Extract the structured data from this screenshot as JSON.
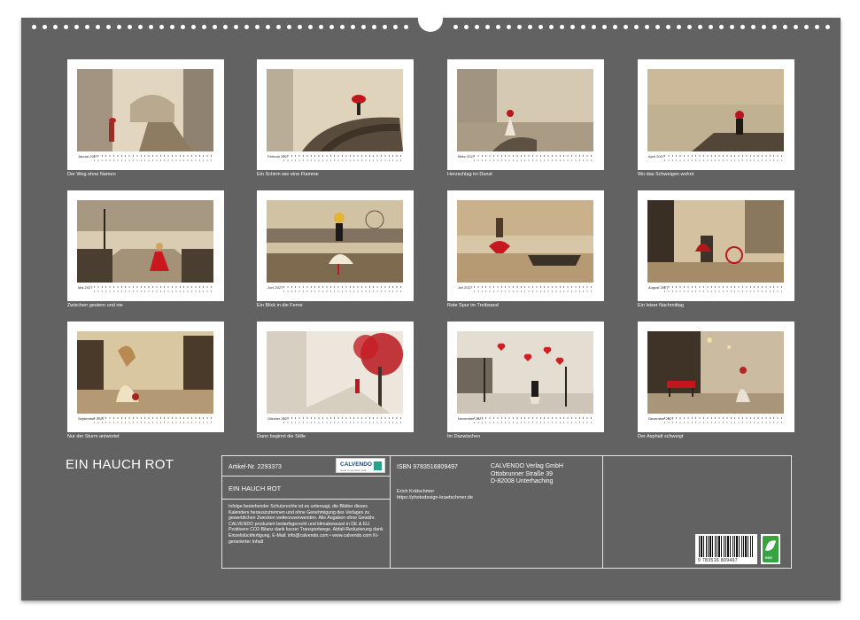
{
  "calendar": {
    "title": "EIN HAUCH ROT",
    "months": [
      {
        "name": "Januar 2027",
        "caption": "Der Weg ohne Namen"
      },
      {
        "name": "Februar 2027",
        "caption": "Ein Schirm wie eine Flamme"
      },
      {
        "name": "März 2027",
        "caption": "Herzschlag im Dunst"
      },
      {
        "name": "April 2027",
        "caption": "Wo das Schweigen wohnt"
      },
      {
        "name": "Mai 2027",
        "caption": "Zwischen gestern und nie"
      },
      {
        "name": "Juni 2027",
        "caption": "Ein Blick in die Ferne"
      },
      {
        "name": "Juli 2027",
        "caption": "Rote Spur im Treibsand"
      },
      {
        "name": "August 2027",
        "caption": "Ein leiser Nachmittag"
      },
      {
        "name": "September 2027",
        "caption": "Nur der Sturm antwortet"
      },
      {
        "name": "Oktober 2027",
        "caption": "Dann beginnt die Stille"
      },
      {
        "name": "November 2027",
        "caption": "Im Dazwischen"
      },
      {
        "name": "Dezember 2027",
        "caption": "Der Asphalt schweigt"
      }
    ]
  },
  "info": {
    "article": "Artikel-Nr. 2293373",
    "product_title": "EIN HAUCH ROT",
    "isbn": "ISBN 9783516809497",
    "publisher": [
      "CALVENDO Verlag GmbH",
      "Ottobrunner Straße 39",
      "D-82008 Unterhaching"
    ],
    "author": "Erich Krätschmer",
    "author_url": "https://photodesign-kraetschmer.de",
    "legal": "Infolge bestehender Schutzrechte ist es untersagt, die Blätter dieses Kalenders herauszutrennen und ohne Genehmigung des Verlages zu gewerblichen Zwecken weiterzuverwenden. Alle Angaben ohne Gewähr. CALVENDO produziert bedarfsgerecht und klimabewusst in DE & EU. Positivere CO2-Bilanz dank kurzer Transportwege. Abfall-Reduzierung dank Einzelstückfertigung. E-Mail: info@calvendo.com • www.calvendo.com KI-generierter Inhalt",
    "logo_text": "CALVENDO",
    "logo_sub": "Jeder Augenblick zählt",
    "barcode_number": "9 783516 809497",
    "eco_label": "eco"
  },
  "colors": {
    "background": "#626262",
    "accent_red": "#c4151c",
    "sepia": "#d9cdb8"
  }
}
